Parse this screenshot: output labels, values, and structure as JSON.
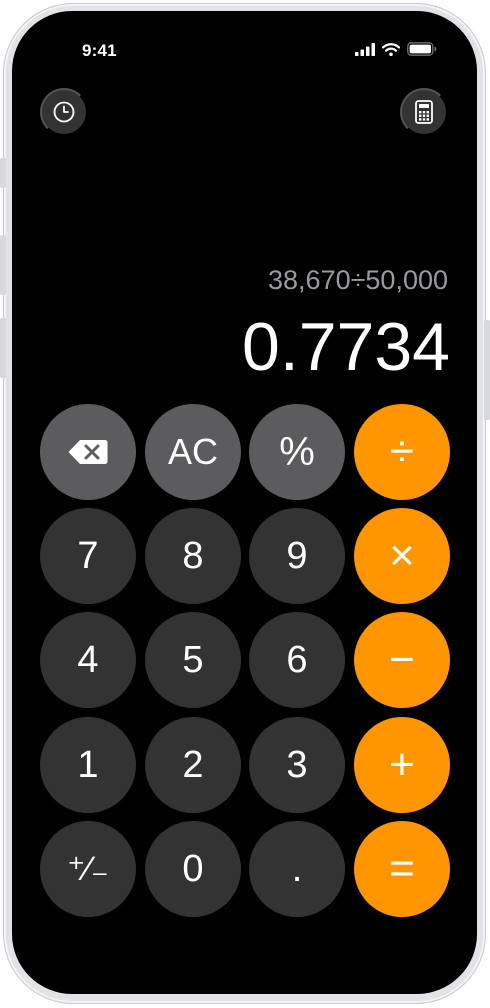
{
  "status_bar": {
    "time": "9:41"
  },
  "toolbar": {
    "history_icon": "clock-icon",
    "mode_icon": "calculator-icon"
  },
  "display": {
    "expression": "38,670÷50,000",
    "result": "0.7734"
  },
  "keypad": {
    "row1": {
      "backspace_icon": "delete-backward-icon",
      "clear": "AC",
      "percent": "%",
      "divide": "÷"
    },
    "row2": {
      "seven": "7",
      "eight": "8",
      "nine": "9",
      "multiply": "×"
    },
    "row3": {
      "four": "4",
      "five": "5",
      "six": "6",
      "minus": "−"
    },
    "row4": {
      "one": "1",
      "two": "2",
      "three": "3",
      "plus": "+"
    },
    "row5": {
      "sign": "⁺∕₋",
      "zero": "0",
      "decimal": ".",
      "equals": "="
    }
  },
  "colors": {
    "background": "#000000",
    "number_key": "#333333",
    "function_key": "#5c5c5f",
    "operator_key": "#ff9500",
    "expression_text": "#9a9a9f",
    "frame": "#e2e3e6"
  }
}
